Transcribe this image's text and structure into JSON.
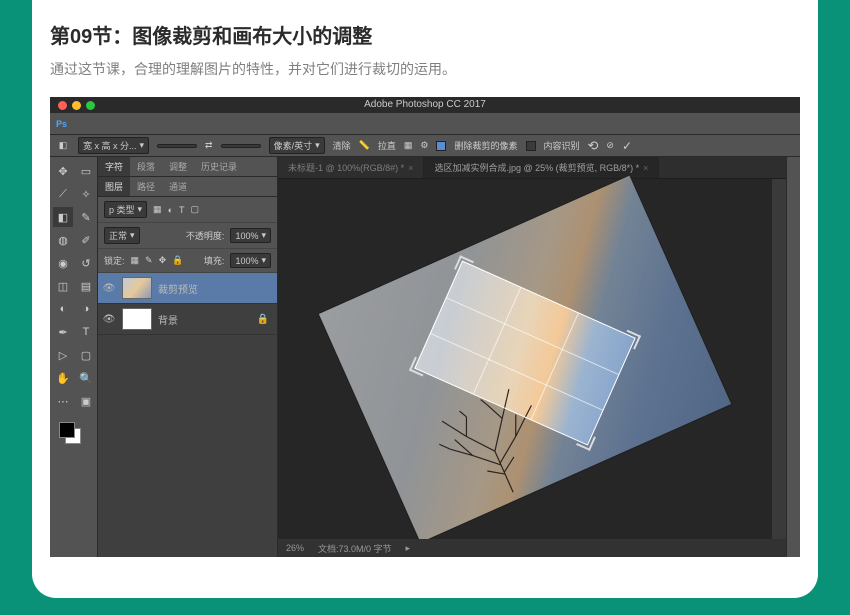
{
  "lesson": {
    "title": "第09节：图像裁剪和画布大小的调整",
    "subtitle": "通过这节课，合理的理解图片的特性，并对它们进行裁切的运用。"
  },
  "app": {
    "title": "Adobe Photoshop CC 2017"
  },
  "mac": {
    "red": "#ff5f57",
    "yellow": "#febc2e",
    "green": "#28c840"
  },
  "menu": {
    "ps": "Ps"
  },
  "opt": {
    "crop_icon": "◧",
    "preset": "宽 x 高 x 分...",
    "unit": "像素/英寸",
    "clear": "清除",
    "straighten": "拉直",
    "delete_px": "删除裁剪的像素",
    "content_aware": "内容识别",
    "reset": "⟲",
    "commit": "✓"
  },
  "panels": {
    "top_tabs": {
      "t1": "字符",
      "t2": "段落",
      "t3": "调整",
      "t4": "历史记录"
    },
    "mid_tabs": {
      "t1": "图层",
      "t2": "路径",
      "t3": "通道"
    },
    "kind": "p 类型",
    "mode": "正常",
    "opacity_lbl": "不透明度:",
    "opacity": "100%",
    "lock_lbl": "锁定:",
    "fill_lbl": "填充:",
    "fill": "100%",
    "layers": [
      {
        "name": "裁剪预览"
      },
      {
        "name": "背景"
      }
    ]
  },
  "file_tabs": {
    "t1": "未标题-1 @ 100%(RGB/8#) *",
    "t2": "选区加减实例合成.jpg @ 25% (裁剪预览, RGB/8*) *"
  },
  "status": {
    "zoom": "26%",
    "info": "文档:73.0M/0 字节"
  },
  "colors": {
    "fg": "#000",
    "bg": "#fff"
  }
}
